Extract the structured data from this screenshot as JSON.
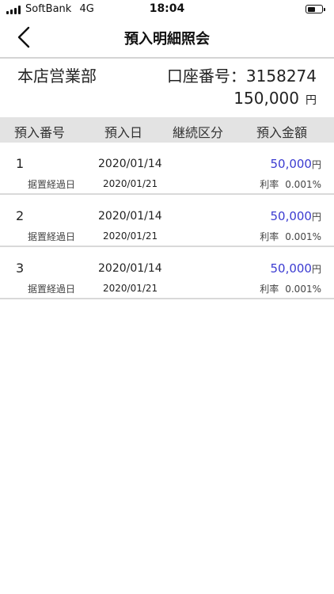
{
  "status_bar": {
    "carrier": "SoftBank",
    "network": "4G",
    "time": "18:04",
    "battery_level": 0.6
  },
  "nav": {
    "title": "預入明細照会",
    "back_icon": "chevron-left-icon"
  },
  "account": {
    "branch": "本店営業部",
    "account_number": "口座番号：3158274",
    "balance": "150,000",
    "balance_unit": "円"
  },
  "table": {
    "headers": [
      "預入番号",
      "預入日",
      "継続区分",
      "預入金額"
    ],
    "rows": [
      {
        "number": "1",
        "deposit_date": "2020/01/14",
        "amount": "50,000",
        "unit": "円",
        "sub_label": "据置経過日",
        "sub_date": "2020/01/21",
        "rate_label": "利率",
        "rate": "0.001%"
      },
      {
        "number": "2",
        "deposit_date": "2020/01/14",
        "amount": "50,000",
        "unit": "円",
        "sub_label": "据置経過日",
        "sub_date": "2020/01/21",
        "rate_label": "利率",
        "rate": "0.001%"
      },
      {
        "number": "3",
        "deposit_date": "2020/01/14",
        "amount": "50,000",
        "unit": "円",
        "sub_label": "据置経過日",
        "sub_date": "2020/01/21",
        "rate_label": "利率",
        "rate": "0.001%"
      }
    ]
  },
  "colors": {
    "amount": "#3b3bd1",
    "header_bg": "#e3e3e3"
  }
}
